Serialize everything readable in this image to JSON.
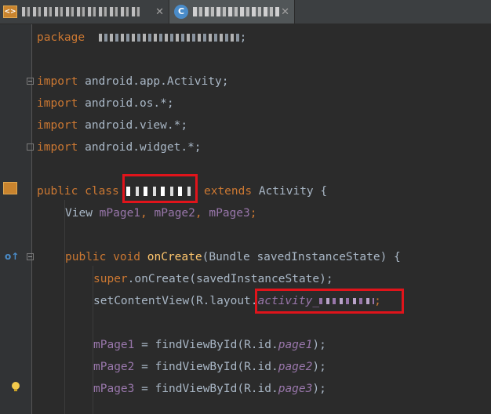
{
  "tabs": [
    {
      "icon": "android-file-icon",
      "label": "",
      "active": false
    },
    {
      "icon": "class-icon",
      "icon_letter": "C",
      "label": "",
      "active": true
    }
  ],
  "code": {
    "package_kw": "package",
    "package_end": ";",
    "imports": [
      {
        "kw": "import",
        "path": " android.app.Activity;"
      },
      {
        "kw": "import",
        "path": " android.os.*;"
      },
      {
        "kw": "import",
        "path": " android.view.*;"
      },
      {
        "kw": "import",
        "path": " android.widget.*;"
      }
    ],
    "class_line": {
      "public": "public",
      "class": " class",
      "extends": "extends",
      "parent": " Activity {"
    },
    "fields_line": {
      "type": "View ",
      "f1": "mPage1",
      "sep1": ", ",
      "f2": "mPage2",
      "sep2": ", ",
      "f3": "mPage3",
      "end": ";"
    },
    "oncreate_line": {
      "mods": "public void ",
      "name": "onCreate",
      "params": "(Bundle savedInstanceState) {"
    },
    "super_line": {
      "kw": "super",
      "rest": ".onCreate(savedInstanceState);"
    },
    "setcontent_line": {
      "pre": "setContentView(R.layout.",
      "layout": "activity_",
      "end": ";"
    },
    "find_lines": [
      {
        "field": "mPage1",
        "mid": " = findViewById(R.id.",
        "id": "page1",
        "end": ");"
      },
      {
        "field": "mPage2",
        "mid": " = findViewById(R.id.",
        "id": "page2",
        "end": ");"
      },
      {
        "field": "mPage3",
        "mid": " = findViewById(R.id.",
        "id": "page3",
        "end": ");"
      }
    ]
  },
  "colors": {
    "keyword": "#cc7832",
    "field": "#9876aa",
    "method": "#ffc66d",
    "text": "#a9b7c6",
    "highlight": "#e0141b",
    "background": "#2b2b2b"
  }
}
